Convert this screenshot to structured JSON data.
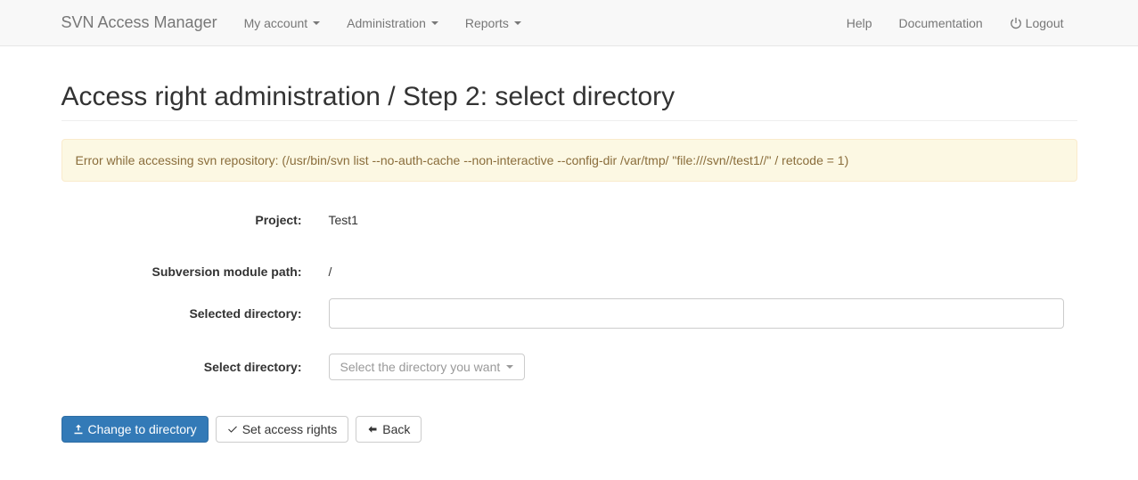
{
  "navbar": {
    "brand": "SVN Access Manager",
    "left": [
      {
        "label": "My account",
        "dropdown": true
      },
      {
        "label": "Administration",
        "dropdown": true
      },
      {
        "label": "Reports",
        "dropdown": true
      }
    ],
    "right": [
      {
        "label": "Help"
      },
      {
        "label": "Documentation"
      },
      {
        "label": "Logout",
        "icon": "power"
      }
    ]
  },
  "page": {
    "title": "Access right administration / Step 2: select directory"
  },
  "alert": {
    "message": "Error while accessing svn repository: (/usr/bin/svn list --no-auth-cache --non-interactive --config-dir /var/tmp/ \"file:///svn//test1//\" / retcode = 1)"
  },
  "form": {
    "project_label": "Project:",
    "project_value": "Test1",
    "module_path_label": "Subversion module path:",
    "module_path_value": "/",
    "selected_dir_label": "Selected directory:",
    "selected_dir_value": "",
    "select_dir_label": "Select directory:",
    "select_dir_placeholder": "Select the directory you want"
  },
  "buttons": {
    "change": "Change to directory",
    "set_rights": "Set access rights",
    "back": "Back"
  }
}
